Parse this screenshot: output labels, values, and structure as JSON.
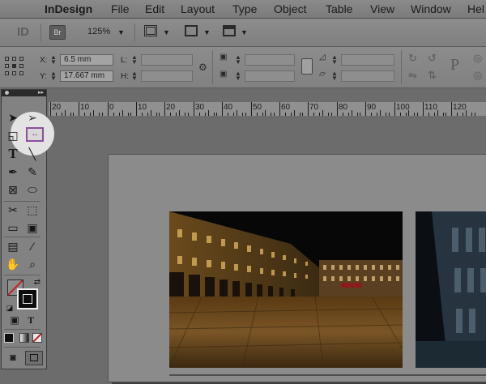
{
  "menubar": {
    "app_name": "InDesign",
    "items": [
      "File",
      "Edit",
      "Layout",
      "Type",
      "Object",
      "Table",
      "View",
      "Window",
      "Hel"
    ]
  },
  "appbar": {
    "logo": "ID",
    "bridge_label": "Br",
    "zoom": "125%"
  },
  "control": {
    "x_label": "X:",
    "x_value": "6.5 mm",
    "y_label": "Y:",
    "y_value": "17.667 mm",
    "w_label": "L:",
    "h_label": "H:",
    "p_label": "P"
  },
  "ruler": {
    "labels": [
      "20",
      "10",
      "0",
      "10",
      "20",
      "30",
      "40",
      "50",
      "60",
      "70",
      "80",
      "90",
      "100",
      "110",
      "120"
    ]
  },
  "tools": {
    "type_label": "T",
    "text_label": "T"
  },
  "colors": {
    "highlight": "#e3e3e3",
    "gap_tool": "#8a4f9e"
  }
}
